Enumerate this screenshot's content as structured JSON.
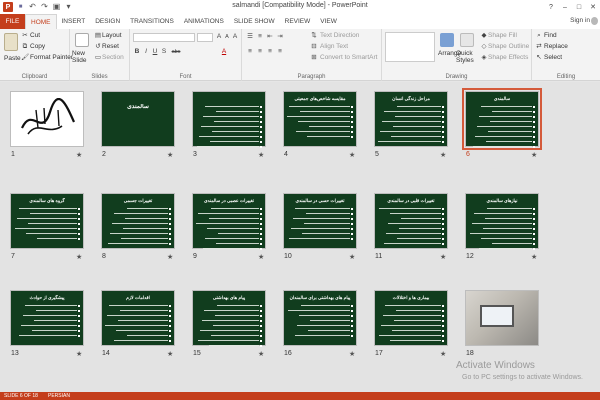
{
  "window": {
    "title": "salmandi [Compatibility Mode] - PowerPoint",
    "app_icon": "P",
    "help": "?",
    "minimize": "–",
    "maximize": "□",
    "close": "✕"
  },
  "qat": {
    "save": "■",
    "undo": "↶",
    "redo": "↷",
    "start": "▣",
    "customize": "▾"
  },
  "tabs": {
    "file": "FILE",
    "items": [
      "HOME",
      "INSERT",
      "DESIGN",
      "TRANSITIONS",
      "ANIMATIONS",
      "SLIDE SHOW",
      "REVIEW",
      "VIEW"
    ],
    "active": "HOME"
  },
  "signin": "Sign in",
  "ribbon": {
    "clipboard": {
      "label": "Clipboard",
      "paste": "Paste",
      "cut": "Cut",
      "copy": "Copy",
      "format_painter": "Format Painter"
    },
    "slides": {
      "label": "Slides",
      "new_slide": "New Slide",
      "layout": "Layout",
      "reset": "Reset",
      "section": "Section"
    },
    "font": {
      "label": "Font",
      "bold": "B",
      "italic": "I",
      "underline": "U",
      "strike": "S",
      "shadow": "abc",
      "font_color": "A",
      "grow": "A",
      "shrink": "A",
      "clear": "A"
    },
    "paragraph": {
      "label": "Paragraph",
      "text_direction": "Text Direction",
      "align_text": "Align Text",
      "convert": "Convert to SmartArt"
    },
    "drawing": {
      "label": "Drawing",
      "arrange": "Arrange",
      "quick_styles": "Quick Styles",
      "fill": "Shape Fill",
      "outline": "Shape Outline",
      "effects": "Shape Effects"
    },
    "editing": {
      "label": "Editing",
      "find": "Find",
      "replace": "Replace",
      "select": "Select"
    }
  },
  "slides": [
    {
      "num": "1",
      "title": "",
      "kind": "logo"
    },
    {
      "num": "2",
      "title": "سالمندی",
      "kind": "title"
    },
    {
      "num": "3",
      "title": "",
      "kind": "text"
    },
    {
      "num": "4",
      "title": "مقایسه شاخص‌های جمعیتی",
      "kind": "text"
    },
    {
      "num": "5",
      "title": "مراحل زندگی انسان",
      "kind": "text"
    },
    {
      "num": "6",
      "title": "سالمندی",
      "kind": "text"
    },
    {
      "num": "7",
      "title": "گروه های سالمندی",
      "kind": "text"
    },
    {
      "num": "8",
      "title": "تغییرات جسمی",
      "kind": "text"
    },
    {
      "num": "9",
      "title": "تغییرات عصبی در سالمندی",
      "kind": "text"
    },
    {
      "num": "10",
      "title": "تغییرات حسی در سالمندی",
      "kind": "text"
    },
    {
      "num": "11",
      "title": "تغییرات قلبی در سالمندی",
      "kind": "text"
    },
    {
      "num": "12",
      "title": "نیازهای سالمندی",
      "kind": "text"
    },
    {
      "num": "13",
      "title": "پیشگیری از حوادث",
      "kind": "text"
    },
    {
      "num": "14",
      "title": "اقدامات لازم",
      "kind": "text"
    },
    {
      "num": "15",
      "title": "پیام های بهداشتی",
      "kind": "text"
    },
    {
      "num": "16",
      "title": "پیام های بهداشتی برای سالمندان",
      "kind": "text"
    },
    {
      "num": "17",
      "title": "بیماری ها و اختلالات",
      "kind": "text"
    },
    {
      "num": "18",
      "title": "",
      "kind": "photo"
    }
  ],
  "slide_star": "★",
  "watermark": {
    "line1": "Activate Windows",
    "line2": "Go to PC settings to activate Windows."
  },
  "status": {
    "slide_info": "SLIDE 6 OF 18",
    "language": "PERSIAN"
  },
  "colors": {
    "accent": "#c43e1c",
    "slide_bg": "#113d1e",
    "selection": "#d45a3a"
  }
}
